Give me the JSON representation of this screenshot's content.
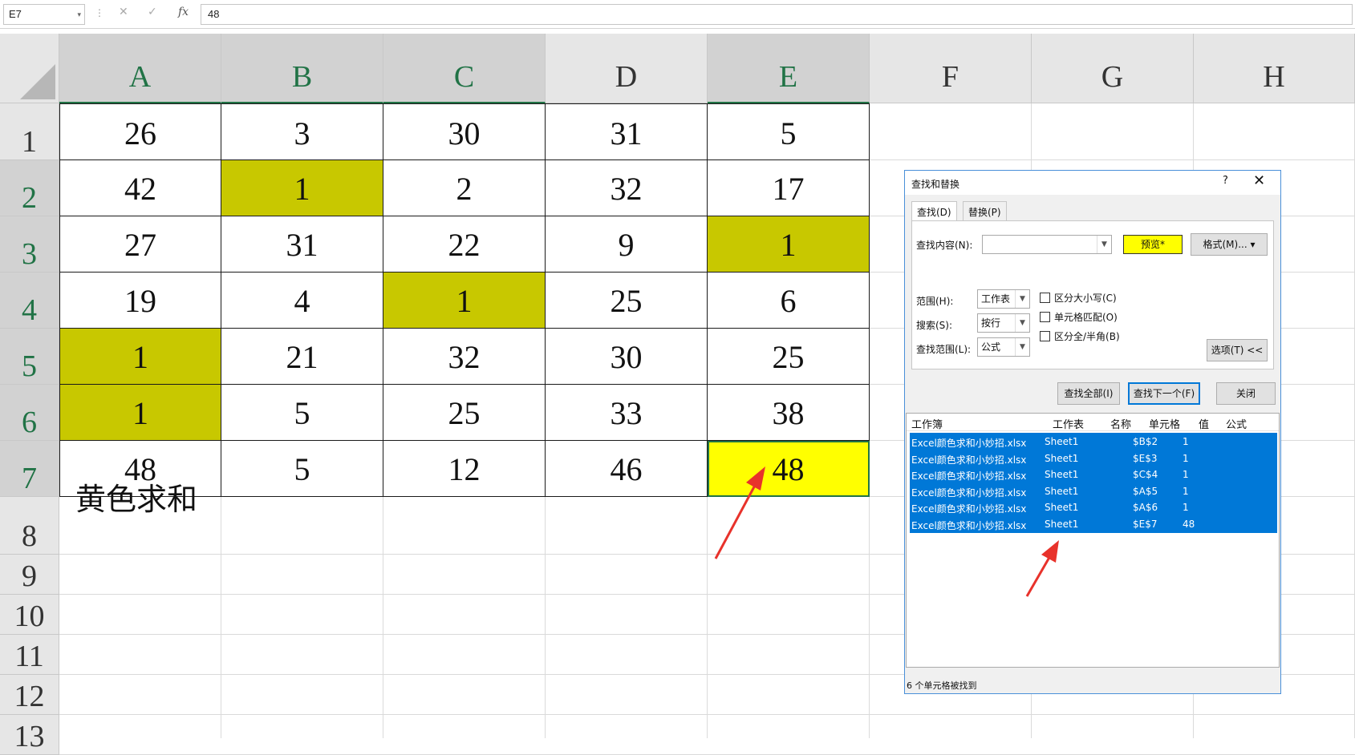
{
  "formula_bar": {
    "name_box": "E7",
    "dropdown_glyph": "▾",
    "separator": "⋮",
    "cancel_glyph": "✕",
    "enter_glyph": "✓",
    "fx_label": "fx",
    "formula": "48"
  },
  "columns": [
    "A",
    "B",
    "C",
    "D",
    "E",
    "F",
    "G",
    "H"
  ],
  "rows": [
    "1",
    "2",
    "3",
    "4",
    "5",
    "6",
    "7",
    "8",
    "9",
    "10",
    "11",
    "12",
    "13"
  ],
  "cells": [
    [
      "26",
      "3",
      "30",
      "31",
      "5"
    ],
    [
      "42",
      "1",
      "2",
      "32",
      "17"
    ],
    [
      "27",
      "31",
      "22",
      "9",
      "1"
    ],
    [
      "19",
      "4",
      "1",
      "25",
      "6"
    ],
    [
      "1",
      "21",
      "32",
      "30",
      "25"
    ],
    [
      "1",
      "5",
      "25",
      "33",
      "38"
    ],
    [
      "48",
      "5",
      "12",
      "46",
      "48"
    ]
  ],
  "fills": {
    "olive": "#c8c800",
    "yellow": "#ffff00",
    "olive_cells": [
      "B2",
      "E3",
      "C4",
      "A5",
      "A6"
    ],
    "yellow_cells": [
      "E7"
    ]
  },
  "a8_text": "黄色求和",
  "dialog": {
    "title": "查找和替换",
    "help": "?",
    "close": "✕",
    "tabs": [
      "查找(D)",
      "替换(P)"
    ],
    "find_label": "查找内容(N):",
    "find_value": "",
    "preview_label": "预览*",
    "format_label": "格式(M)...",
    "within_label": "范围(H):",
    "within_value": "工作表",
    "search_label": "搜索(S):",
    "search_value": "按行",
    "lookin_label": "查找范围(L):",
    "lookin_value": "公式",
    "match_case": "区分大小写(C)",
    "match_entire": "单元格匹配(O)",
    "match_width": "区分全/半角(B)",
    "options_label": "选项(T) <<",
    "find_all": "查找全部(I)",
    "find_next": "查找下一个(F)",
    "close_label": "关闭",
    "results_headers": [
      "工作簿",
      "工作表",
      "名称",
      "单元格",
      "值",
      "公式"
    ],
    "results": [
      {
        "book": "Excel颜色求和小妙招.xlsx",
        "sheet": "Sheet1",
        "cell": "$B$2",
        "value": "1"
      },
      {
        "book": "Excel颜色求和小妙招.xlsx",
        "sheet": "Sheet1",
        "cell": "$E$3",
        "value": "1"
      },
      {
        "book": "Excel颜色求和小妙招.xlsx",
        "sheet": "Sheet1",
        "cell": "$C$4",
        "value": "1"
      },
      {
        "book": "Excel颜色求和小妙招.xlsx",
        "sheet": "Sheet1",
        "cell": "$A$5",
        "value": "1"
      },
      {
        "book": "Excel颜色求和小妙招.xlsx",
        "sheet": "Sheet1",
        "cell": "$A$6",
        "value": "1"
      },
      {
        "book": "Excel颜色求和小妙招.xlsx",
        "sheet": "Sheet1",
        "cell": "$E$7",
        "value": "48"
      }
    ],
    "status": "6 个单元格被找到"
  },
  "annotation_color": "#e8322b"
}
